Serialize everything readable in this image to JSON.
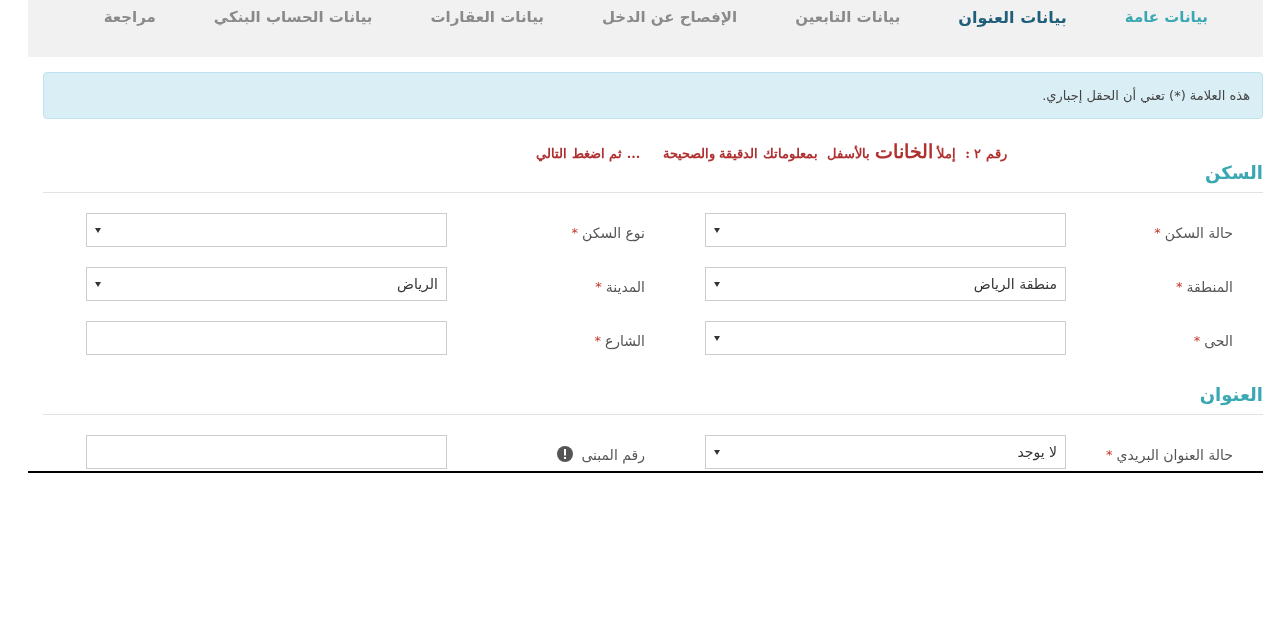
{
  "tabs": [
    {
      "label": "بيانات عامة",
      "selected": false,
      "completed": true
    },
    {
      "label": "بيانات العنوان",
      "selected": true,
      "completed": false
    },
    {
      "label": "بيانات التابعين",
      "selected": false,
      "completed": false
    },
    {
      "label": "الإفصاح عن الدخل",
      "selected": false,
      "completed": false
    },
    {
      "label": "بيانات العقارات",
      "selected": false,
      "completed": false
    },
    {
      "label": "بيانات الحساب البنكي",
      "selected": false,
      "completed": false
    },
    {
      "label": "مراجعة",
      "selected": false,
      "completed": false
    }
  ],
  "notice": "هذه العلامة (*) تعني أن الحقل إجباري.",
  "instruction": {
    "prefix": "رقم ٢ :  إملأ",
    "emphasis": "الخانات",
    "rest": "بالأسفل  بمعلوماتك الدقيقة والصحيحة     ... ثم اضغط التالي"
  },
  "sections": [
    {
      "title": "السكن",
      "rows": [
        [
          {
            "label": "حالة السكن",
            "mark": "*",
            "kind": "select"
          },
          {
            "label": "نوع السكن",
            "mark": "*",
            "kind": "select"
          }
        ],
        [
          {
            "label": "المنطقة",
            "mark": "*",
            "kind": "select",
            "value": "منطقة الرياض"
          },
          {
            "label": "المدينة",
            "mark": "*",
            "kind": "select",
            "value": "الرياض"
          }
        ],
        [
          {
            "label": "الحى",
            "mark": "*",
            "kind": "select"
          },
          {
            "label": "الشارع",
            "mark": "*",
            "kind": "text"
          }
        ]
      ]
    },
    {
      "title": "العنوان",
      "rows": [
        [
          {
            "label": "حالة العنوان البريدي",
            "mark": "*",
            "kind": "select",
            "value": "لا يوجد"
          },
          {
            "label": "رقم المبنى",
            "info": true,
            "kind": "text"
          }
        ]
      ]
    }
  ]
}
